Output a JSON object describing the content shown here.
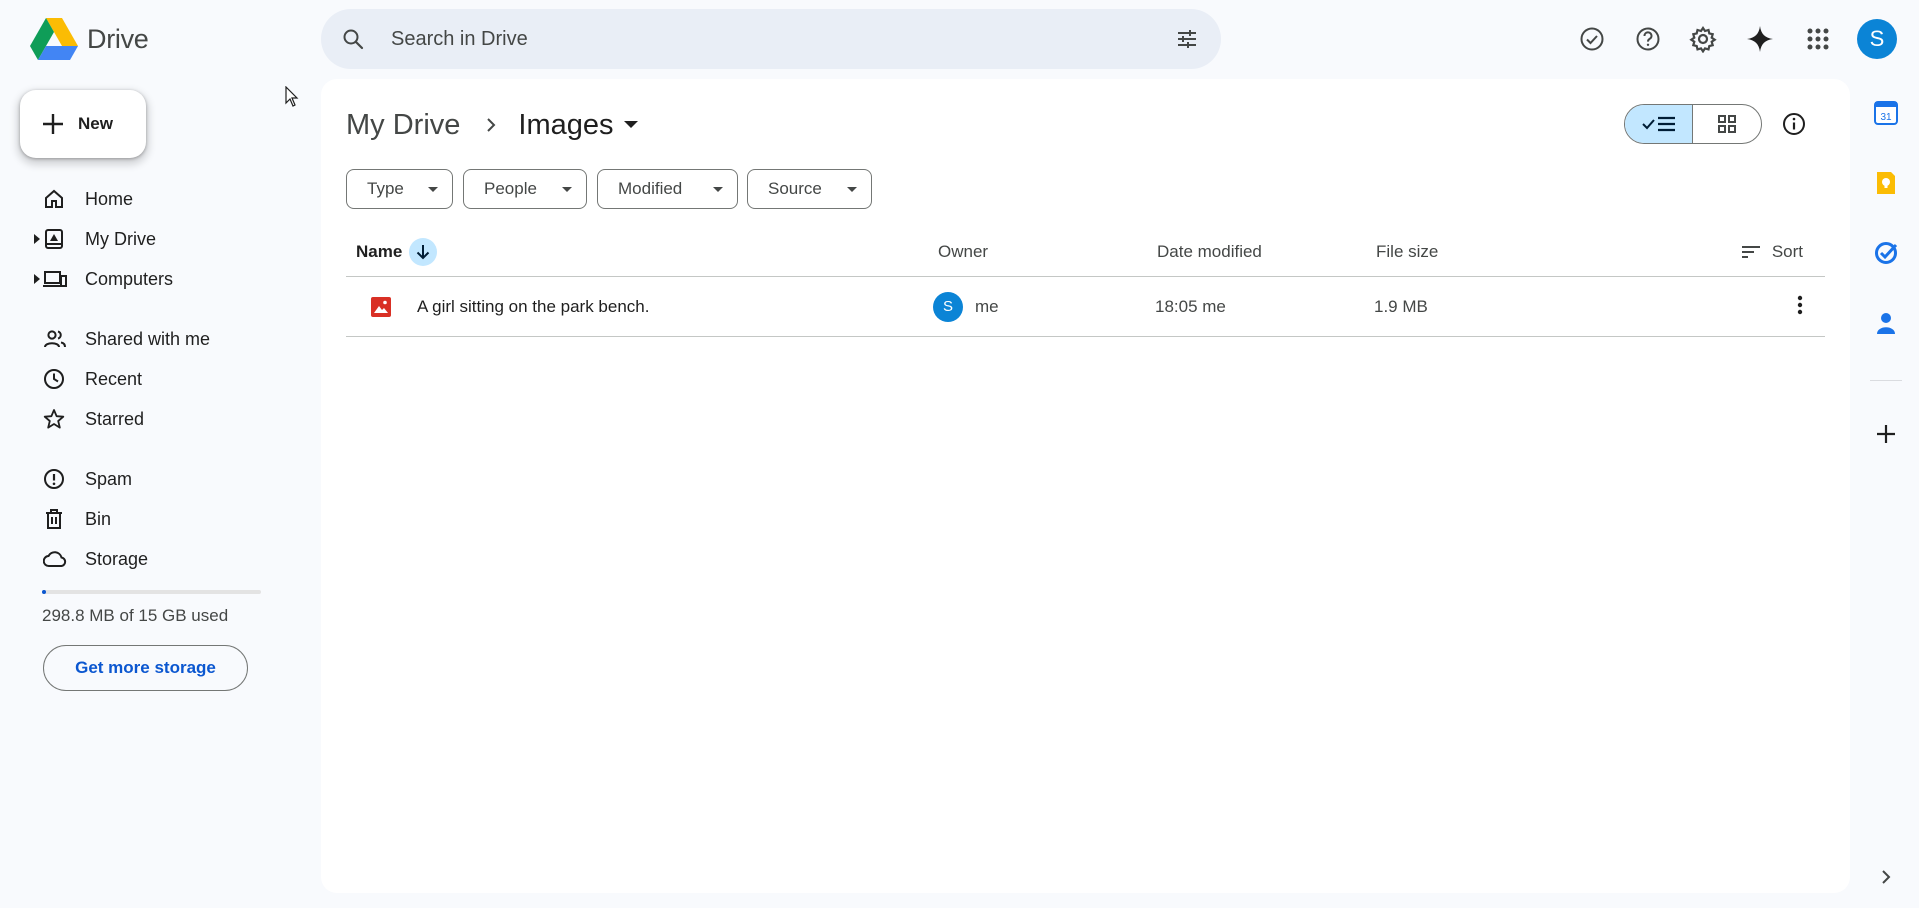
{
  "app": {
    "name": "Drive"
  },
  "search": {
    "placeholder": "Search in Drive"
  },
  "header_icons": [
    "ready-for-offline-icon",
    "help-icon",
    "settings-icon",
    "gemini-icon",
    "apps-grid-icon"
  ],
  "account": {
    "initial": "S",
    "color": "#0b84d6"
  },
  "new_button": {
    "label": "New"
  },
  "sidebar": {
    "items": [
      {
        "label": "Home",
        "icon": "home-icon"
      },
      {
        "label": "My Drive",
        "icon": "my-drive-icon",
        "expandable": true
      },
      {
        "label": "Computers",
        "icon": "computers-icon",
        "expandable": true
      },
      {
        "label": "Shared with me",
        "icon": "shared-icon"
      },
      {
        "label": "Recent",
        "icon": "clock-icon"
      },
      {
        "label": "Starred",
        "icon": "star-icon"
      },
      {
        "label": "Spam",
        "icon": "spam-icon"
      },
      {
        "label": "Bin",
        "icon": "bin-icon"
      },
      {
        "label": "Storage",
        "icon": "cloud-icon"
      }
    ]
  },
  "storage": {
    "used_text": "298.8 MB of 15 GB used",
    "used_fraction": 0.02,
    "button_label": "Get more storage"
  },
  "breadcrumb": {
    "root": "My Drive",
    "current": "Images"
  },
  "filters": [
    "Type",
    "People",
    "Modified",
    "Source"
  ],
  "table": {
    "columns": {
      "name": "Name",
      "owner": "Owner",
      "modified": "Date modified",
      "size": "File size",
      "sort": "Sort"
    },
    "rows": [
      {
        "name": "A girl sitting on the park bench.",
        "type_icon": "image-file-icon",
        "owner_initial": "S",
        "owner": "me",
        "modified": "18:05 me",
        "size": "1.9 MB"
      }
    ]
  },
  "side_panel": {
    "apps": [
      "calendar-icon",
      "keep-icon",
      "tasks-icon",
      "contacts-icon"
    ],
    "calendar_day": "31"
  },
  "colors": {
    "accent": "#0b57d0",
    "selected": "#c2e7ff",
    "image_icon": "#d93025",
    "background": "#f8fafd"
  }
}
